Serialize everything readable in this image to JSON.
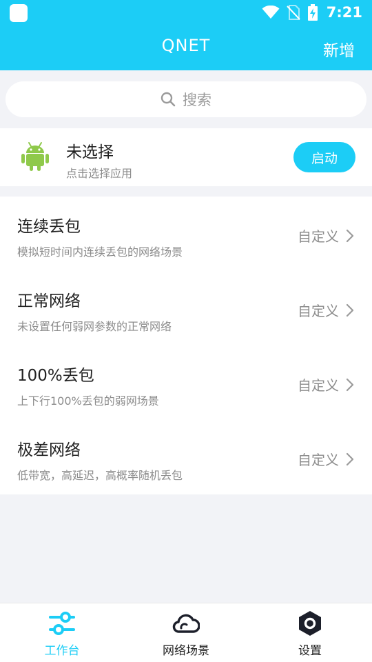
{
  "status_bar": {
    "time": "7:21"
  },
  "header": {
    "title": "QNET",
    "add_label": "新增"
  },
  "search": {
    "placeholder": "搜索"
  },
  "app_selector": {
    "title": "未选择",
    "subtitle": "点击选择应用",
    "start_label": "启动",
    "icon": "android-icon"
  },
  "scenarios": [
    {
      "title": "连续丢包",
      "desc": "模拟短时间内连续丢包的网络场景",
      "action": "自定义"
    },
    {
      "title": "正常网络",
      "desc": "未设置任何弱网参数的正常网络",
      "action": "自定义"
    },
    {
      "title": "100%丢包",
      "desc": "上下行100%丢包的弱网场景",
      "action": "自定义"
    },
    {
      "title": "极差网络",
      "desc": "低带宽，高延迟，高概率随机丢包",
      "action": "自定义"
    }
  ],
  "bottom_nav": [
    {
      "label": "工作台",
      "icon": "sliders-icon",
      "active": true
    },
    {
      "label": "网络场景",
      "icon": "cloud-icon",
      "active": false
    },
    {
      "label": "设置",
      "icon": "hexagon-gear-icon",
      "active": false
    }
  ],
  "colors": {
    "accent": "#1ccdf6",
    "android_green": "#8fc94b",
    "nav_dark": "#1c1f2a"
  }
}
